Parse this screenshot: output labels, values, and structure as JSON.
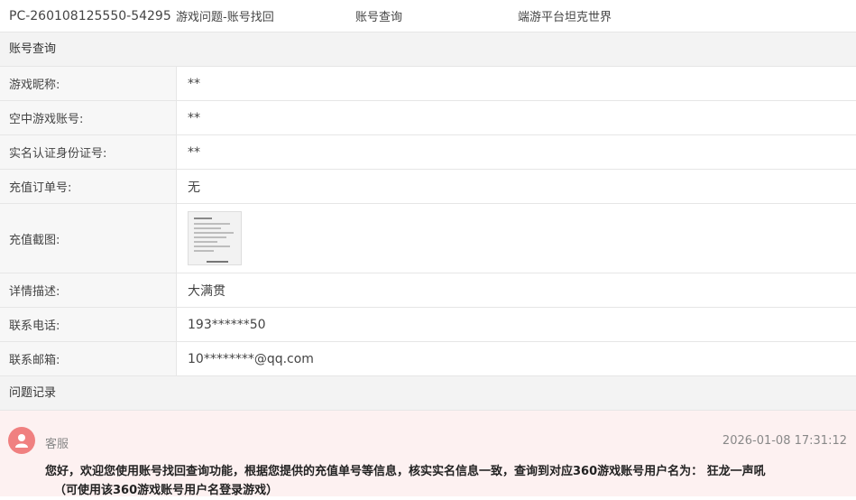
{
  "header": {
    "ticket_id": "PC-260108125550-54295",
    "category": "游戏问题-账号找回",
    "query_type": "账号查询",
    "game": "端游平台坦克世界"
  },
  "account_section": {
    "title": "账号查询",
    "rows": [
      {
        "label": "游戏昵称:",
        "value": "**"
      },
      {
        "label": "空中游戏账号:",
        "value": "**"
      },
      {
        "label": "实名认证身份证号:",
        "value": "**"
      },
      {
        "label": "充值订单号:",
        "value": "无"
      },
      {
        "label": "充值截图:",
        "value": ""
      },
      {
        "label": "详情描述:",
        "value": "大满贯"
      },
      {
        "label": "联系电话:",
        "value": "193******50"
      },
      {
        "label": "联系邮箱:",
        "value": "10********@qq.com"
      }
    ]
  },
  "records_section": {
    "title": "问题记录",
    "record": {
      "author": "客服",
      "time": "2026-01-08 17:31:12",
      "message_line1": "您好，欢迎您使用账号找回查询功能，根据您提供的充值单号等信息，核实实名信息一致，查询到对应360游戏账号用户名为：  狂龙一声吼",
      "message_line2": "（可使用该360游戏账号用户名登录游戏）"
    }
  },
  "colors": {
    "record_bg": "#fdf1f1",
    "avatar": "#f08080",
    "label_bg": "#f7f7f7",
    "section_bg": "#f3f3f3"
  }
}
